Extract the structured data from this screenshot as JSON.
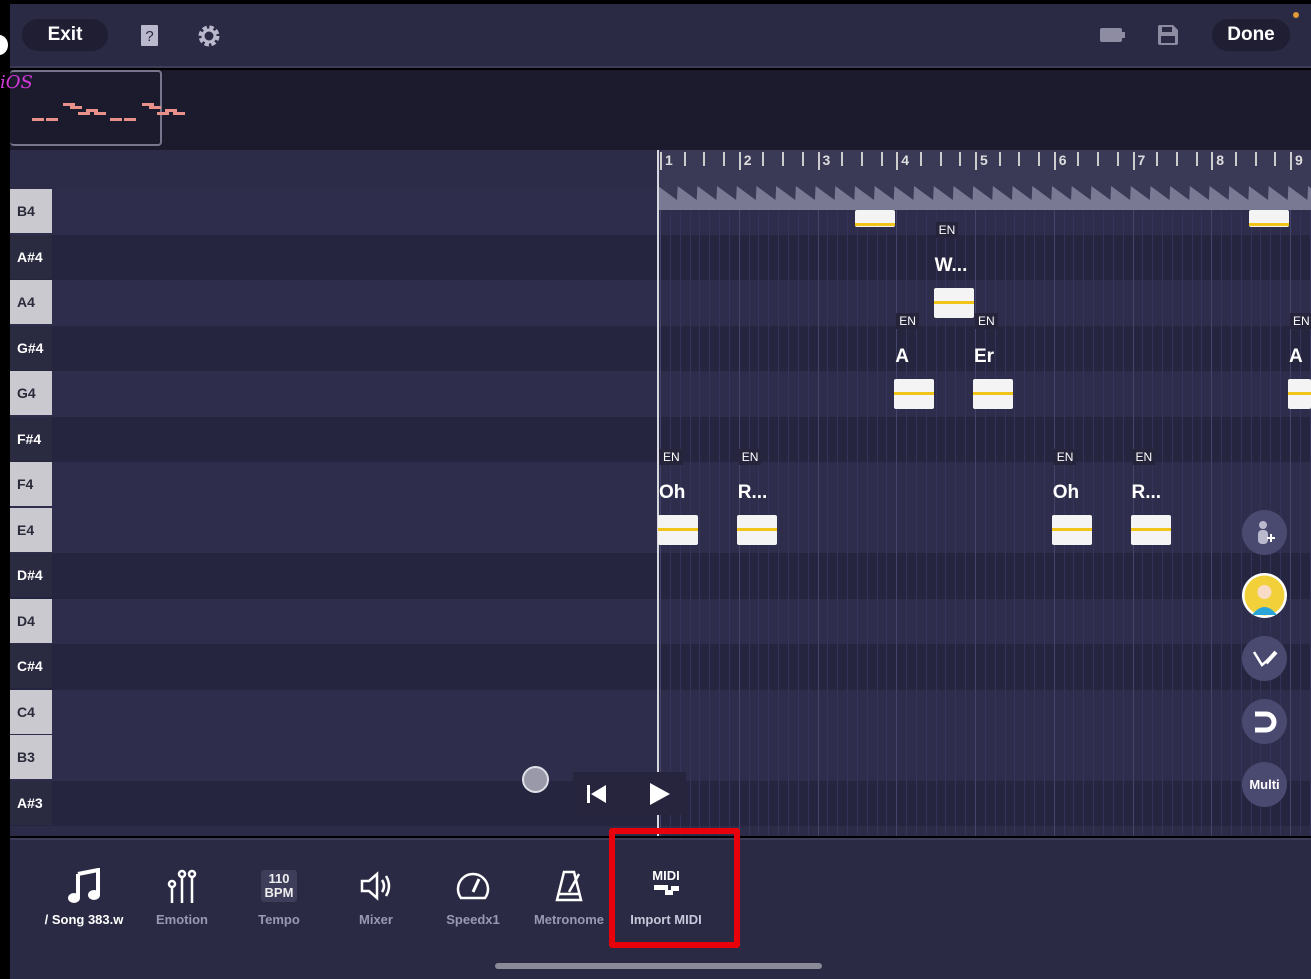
{
  "topbar": {
    "exit_label": "Exit",
    "done_label": "Done",
    "icons": [
      "help-book-icon",
      "gear-icon",
      "battery-icon",
      "save-icon"
    ]
  },
  "overview": {
    "watermark": "iOS"
  },
  "piano_keys": [
    {
      "label": "B4",
      "black": false
    },
    {
      "label": "A#4",
      "black": true
    },
    {
      "label": "A4",
      "black": false
    },
    {
      "label": "G#4",
      "black": true
    },
    {
      "label": "G4",
      "black": false
    },
    {
      "label": "F#4",
      "black": true
    },
    {
      "label": "F4",
      "black": false
    },
    {
      "label": "E4",
      "black": false
    },
    {
      "label": "D#4",
      "black": true
    },
    {
      "label": "D4",
      "black": false
    },
    {
      "label": "C#4",
      "black": true
    },
    {
      "label": "C4",
      "black": false
    },
    {
      "label": "B3",
      "black": false
    },
    {
      "label": "A#3",
      "black": true
    }
  ],
  "ruler": {
    "bars": [
      "1",
      "2",
      "3",
      "4",
      "5",
      "6",
      "7",
      "8",
      "9"
    ]
  },
  "notes": [
    {
      "pitch": "B4",
      "start_bar": 3.5,
      "lang": "",
      "lyric": ""
    },
    {
      "pitch": "B4",
      "start_bar": 8.5,
      "lang": "",
      "lyric": ""
    },
    {
      "pitch": "A4",
      "start_bar": 4.5,
      "lang": "EN",
      "lyric": "W..."
    },
    {
      "pitch": "G4",
      "start_bar": 4.0,
      "lang": "EN",
      "lyric": "A"
    },
    {
      "pitch": "G4",
      "start_bar": 5.0,
      "lang": "EN",
      "lyric": "Er"
    },
    {
      "pitch": "G4",
      "start_bar": 9.0,
      "lang": "EN",
      "lyric": "A"
    },
    {
      "pitch": "E4",
      "start_bar": 1.0,
      "lang": "EN",
      "lyric": "Oh"
    },
    {
      "pitch": "E4",
      "start_bar": 2.0,
      "lang": "EN",
      "lyric": "R..."
    },
    {
      "pitch": "E4",
      "start_bar": 6.0,
      "lang": "EN",
      "lyric": "Oh"
    },
    {
      "pitch": "E4",
      "start_bar": 7.0,
      "lang": "EN",
      "lyric": "R..."
    }
  ],
  "side_tools": {
    "multi_label": "Multi"
  },
  "toolbar": [
    {
      "name": "song",
      "label": "/ Song 383.w",
      "icon": "music-note-icon"
    },
    {
      "name": "emotion",
      "label": "Emotion",
      "icon": "sliders-icon"
    },
    {
      "name": "tempo",
      "label": "Tempo",
      "icon": "tempo-icon",
      "value": "110",
      "unit": "BPM"
    },
    {
      "name": "mixer",
      "label": "Mixer",
      "icon": "speaker-icon"
    },
    {
      "name": "speed",
      "label": "Speedx1",
      "icon": "speedometer-icon"
    },
    {
      "name": "metronome",
      "label": "Metronome",
      "icon": "metronome-icon"
    },
    {
      "name": "import-midi",
      "label": "Import MIDI",
      "icon": "midi-icon",
      "icon_text": "MIDI"
    }
  ],
  "colors": {
    "highlight": "#e8000b",
    "note_line": "#f0c419",
    "background": "#2c2b48"
  }
}
